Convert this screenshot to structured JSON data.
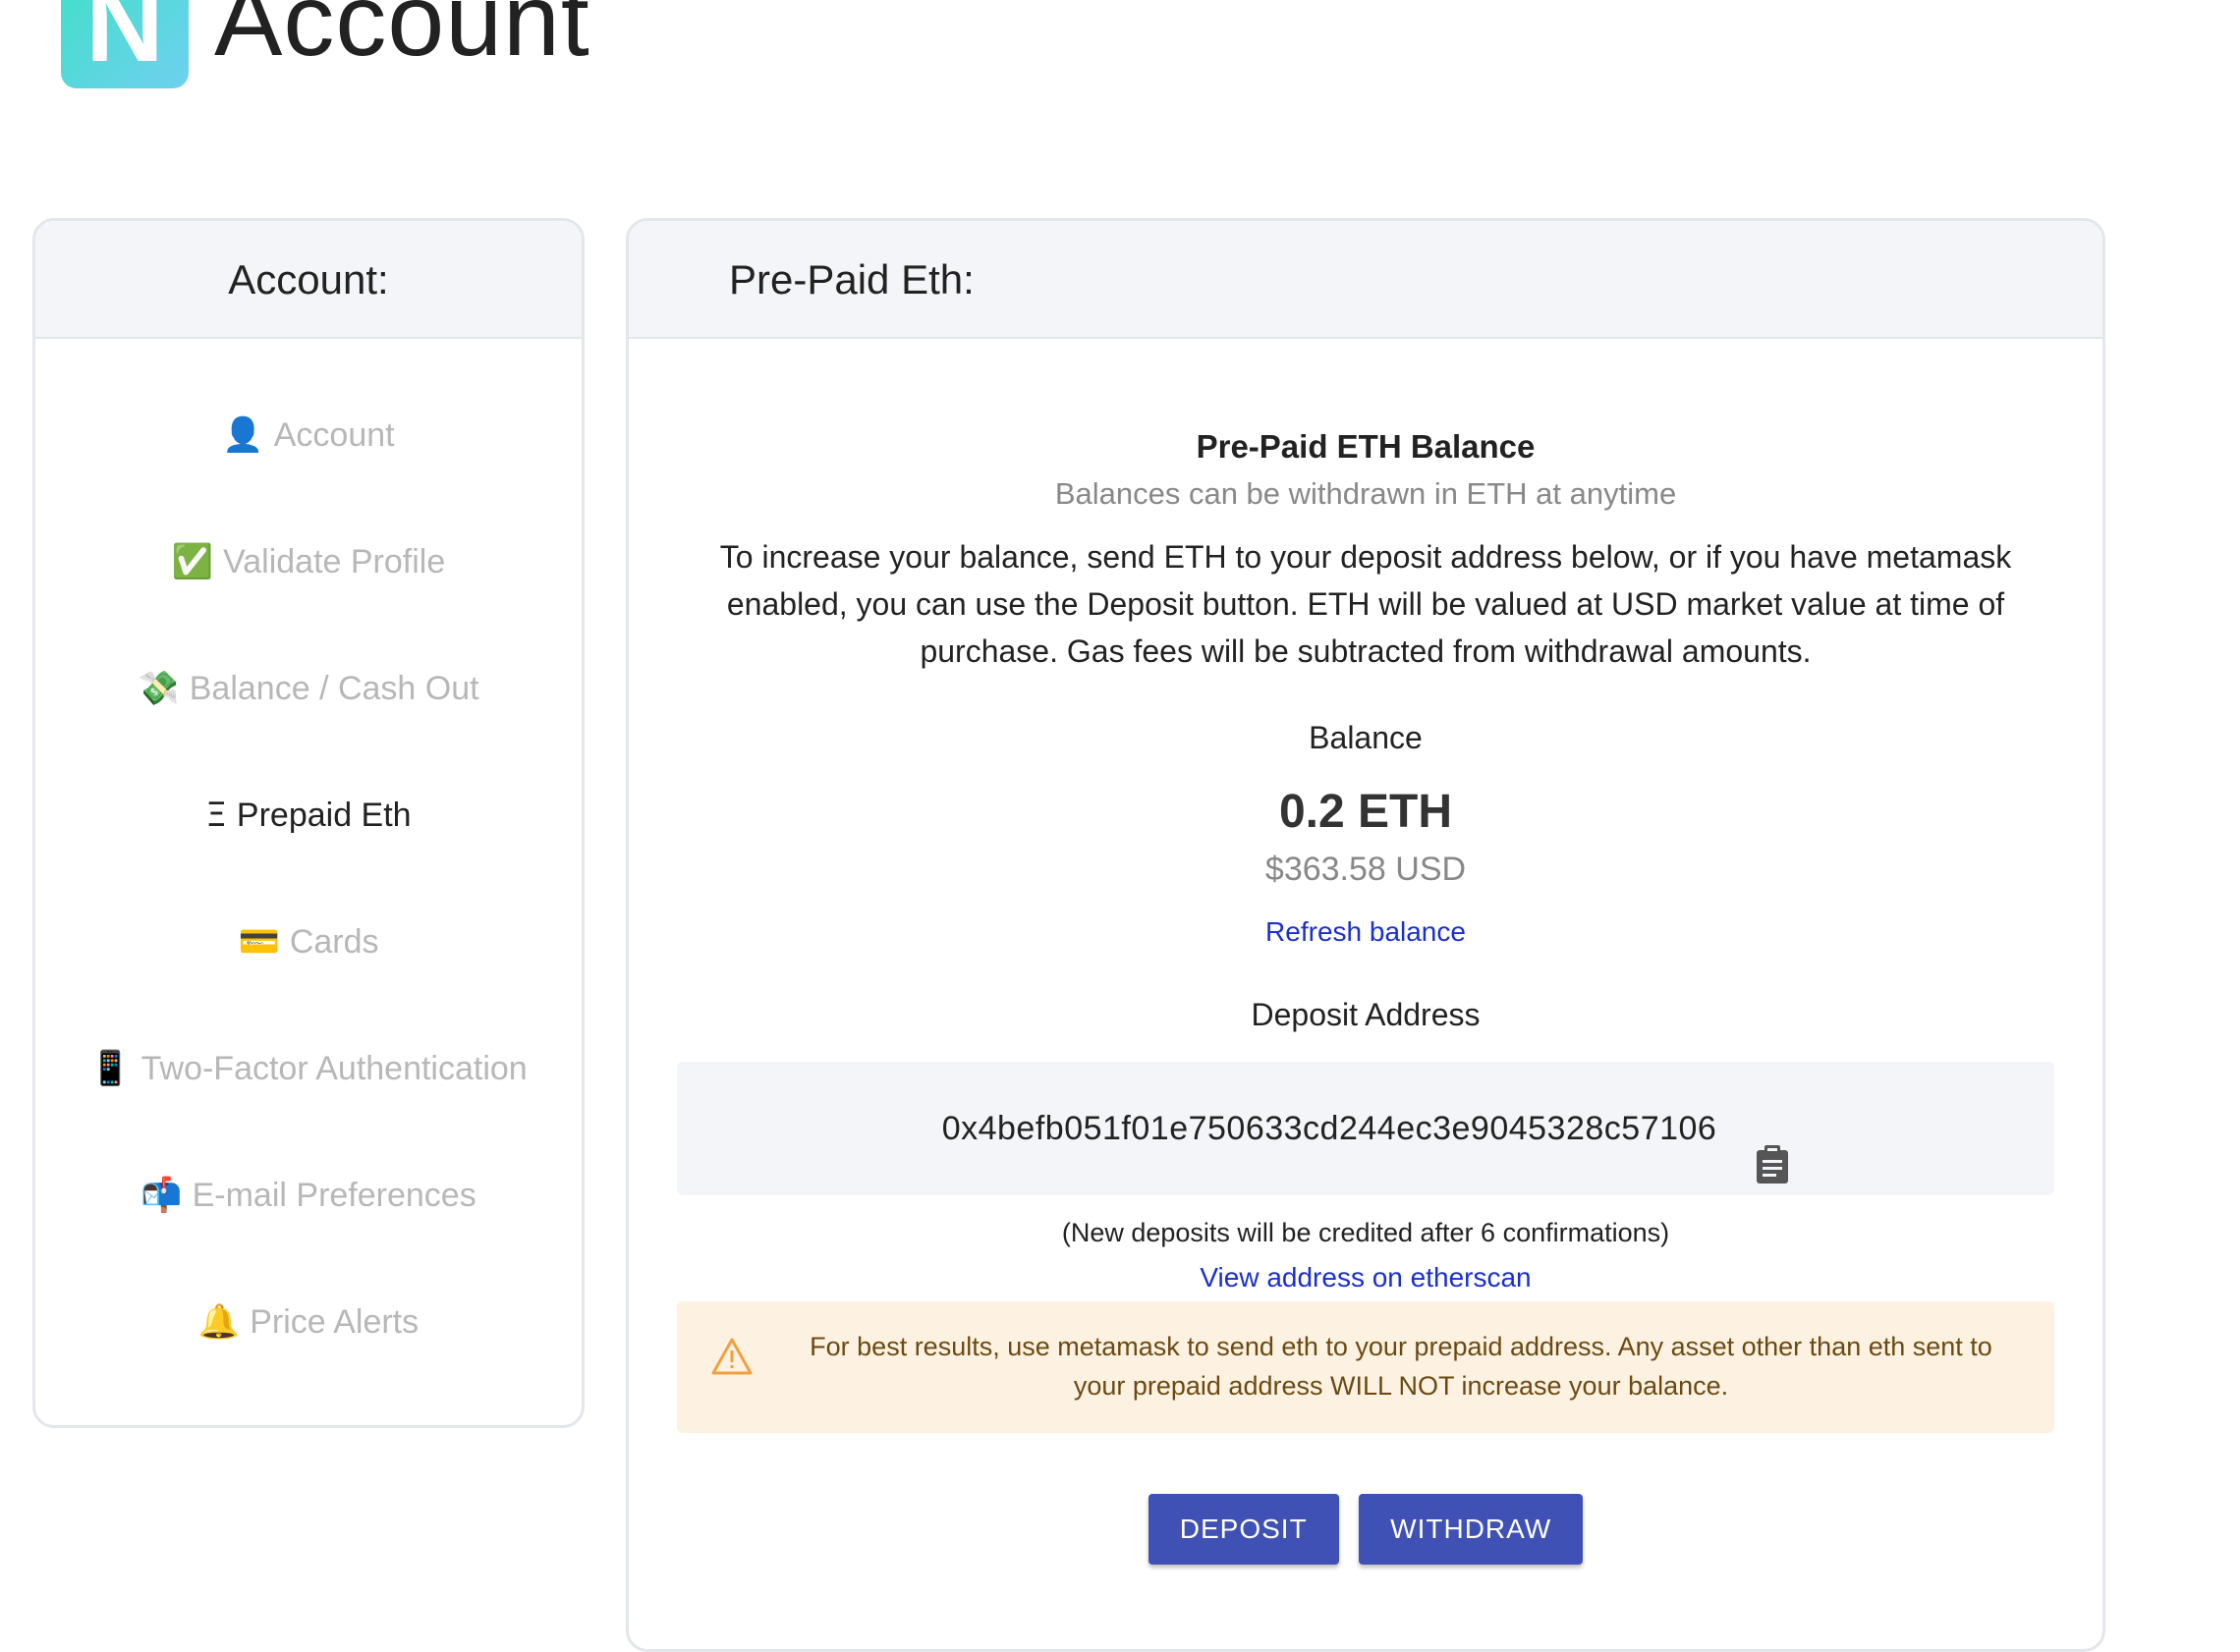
{
  "header": {
    "logo_letter": "N",
    "title": "Account"
  },
  "sidebar": {
    "title": "Account:",
    "items": [
      {
        "icon": "👤",
        "icon_name": "user-icon",
        "label": "Account",
        "active": false
      },
      {
        "icon": "✅",
        "icon_name": "checkmark-icon",
        "label": "Validate Profile",
        "active": false
      },
      {
        "icon": "💸",
        "icon_name": "money-wings-icon",
        "label": "Balance / Cash Out",
        "active": false
      },
      {
        "icon": "Ξ",
        "icon_name": "ethereum-icon",
        "label": "Prepaid Eth",
        "active": true
      },
      {
        "icon": "💳",
        "icon_name": "credit-card-icon",
        "label": "Cards",
        "active": false
      },
      {
        "icon": "📱",
        "icon_name": "mobile-phone-icon",
        "label": "Two-Factor Authentication",
        "active": false
      },
      {
        "icon": "📬",
        "icon_name": "mailbox-icon",
        "label": "E-mail Preferences",
        "active": false
      },
      {
        "icon": "🔔",
        "icon_name": "bell-icon",
        "label": "Price Alerts",
        "active": false
      }
    ]
  },
  "main": {
    "title": "Pre-Paid Eth:",
    "balance_heading": "Pre-Paid ETH Balance",
    "balance_subheading": "Balances can be withdrawn in ETH at anytime",
    "description": "To increase your balance, send ETH to your deposit address below, or if you have metamask enabled, you can use the Deposit button. ETH will be valued at USD market value at time of purchase. Gas fees will be subtracted from withdrawal amounts.",
    "balance_label": "Balance",
    "eth_amount": "0.2 ETH",
    "usd_amount": "$363.58 USD",
    "refresh_link": "Refresh balance",
    "deposit_label": "Deposit Address",
    "deposit_address": "0x4befb051f01e750633cd244ec3e9045328c57106",
    "confirmations_note": "(New deposits will be credited after 6 confirmations)",
    "etherscan_link": "View address on etherscan",
    "warning": "For best results, use metamask to send eth to your prepaid address. Any asset other than eth sent to your prepaid address WILL NOT increase your balance.",
    "deposit_button": "DEPOSIT",
    "withdraw_button": "WITHDRAW"
  },
  "colors": {
    "primary_button": "#3f51b5",
    "link": "#1a2fcf",
    "warning_bg": "#fdf2e2",
    "warning_icon": "#f0a040"
  }
}
